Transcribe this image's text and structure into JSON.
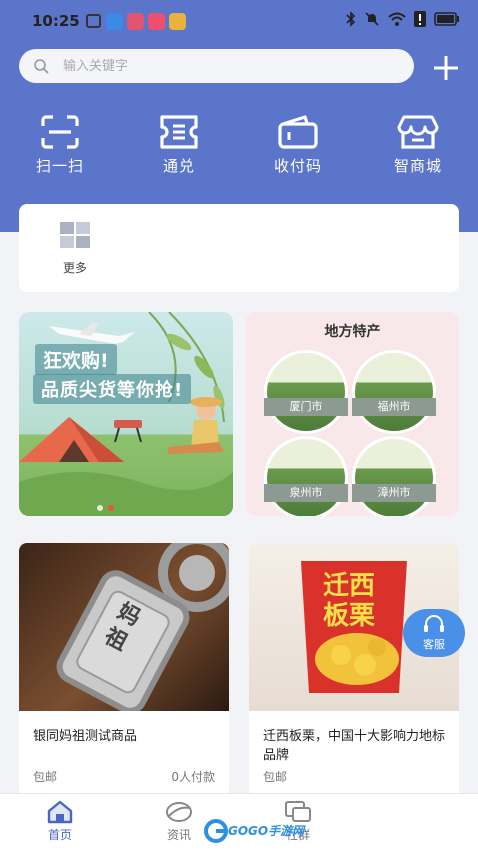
{
  "status_bar": {
    "time": "10:25"
  },
  "search": {
    "placeholder": "输入关键字"
  },
  "quick_actions": [
    {
      "label": "扫一扫",
      "icon": "scan-icon"
    },
    {
      "label": "通兑",
      "icon": "exchange-icon"
    },
    {
      "label": "收付码",
      "icon": "wallet-icon"
    },
    {
      "label": "智商城",
      "icon": "shop-icon"
    }
  ],
  "more": {
    "label": "更多",
    "icon": "grid-icon"
  },
  "promo_banner": {
    "line1": "狂欢购!",
    "line2": "品质尖货等你抢!"
  },
  "specialty": {
    "title": "地方特产",
    "cities": [
      "厦门市",
      "福州市",
      "泉州市",
      "漳州市"
    ]
  },
  "products": [
    {
      "name": "银同妈祖测试商品",
      "shipping": "包邮",
      "buyers": "0人付款",
      "engraving": "妈祖"
    },
    {
      "name": "迁西板栗，中国十大影响力地标品牌",
      "shipping": "包邮",
      "buyers": "",
      "package_text": "迁西板栗"
    }
  ],
  "customer_service": {
    "label": "客服"
  },
  "tabs": [
    {
      "label": "首页",
      "icon": "home-icon",
      "active": true
    },
    {
      "label": "资讯",
      "icon": "news-icon",
      "active": false
    },
    {
      "label": "社群",
      "icon": "community-icon",
      "active": false
    }
  ],
  "watermark": {
    "text": "GOGO手游网"
  },
  "colors": {
    "header": "#5a75c9",
    "active_tab": "#4a66c3",
    "cs_button": "#4a8fe8",
    "dot_active": "#e9592f"
  }
}
